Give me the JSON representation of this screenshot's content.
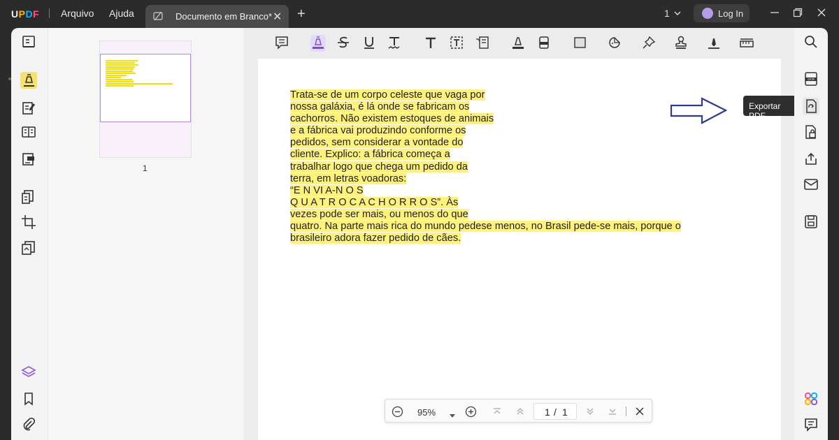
{
  "app": {
    "logo": "UPDF"
  },
  "menu": {
    "file": "Arquivo",
    "help": "Ajuda"
  },
  "tab": {
    "title": "Documento em Branco*"
  },
  "window": {
    "count": "1"
  },
  "account": {
    "login_label": "Log In"
  },
  "thumbnail": {
    "page_number": "1"
  },
  "document": {
    "lines": [
      "Trata-se de um corpo celeste que vaga por",
      "nossa galáxia, é lá onde se fabricam os",
      "cachorros. Não existem estoques de animais",
      "e a fábrica vai produzindo conforme os",
      "pedidos, sem considerar a vontade do",
      "cliente. Explico: a fábrica começa a",
      "trabalhar logo que chega um pedido da",
      "terra, em letras voadoras:",
      "“E N VI A-N O S",
      "Q U A T R O C A C H O R R O S”. Às",
      "vezes pode ser mais, ou menos do que",
      "quatro. Na parte mais rica do mundo pedese menos, no Brasil pede-se mais, porque o",
      "brasileiro adora fazer pedido de cães."
    ],
    "highlight_color": "#fff27a"
  },
  "tooltip": {
    "text": "Exportar PDF"
  },
  "pagenav": {
    "zoom": "95%",
    "current_page": "1",
    "separator": "/",
    "total_pages": "1"
  },
  "colors": {
    "accent": "#b587e0",
    "arrow": "#2c3a96",
    "titlebar": "#2b2b2b"
  },
  "icons": {
    "left_rail": [
      "reader-mode-icon",
      "comment-highlight-icon",
      "edit-pdf-icon",
      "organize-pages-icon",
      "form-icon",
      "convert-icon",
      "crop-icon",
      "page-tools-icon",
      "layers-icon",
      "bookmark-icon",
      "attachment-icon"
    ],
    "toolbar": [
      "note-icon",
      "highlighter-icon",
      "strikethrough-icon",
      "underline-icon",
      "squiggly-icon",
      "text-icon",
      "textbox-icon",
      "text-callout-icon",
      "pencil-icon",
      "eraser-icon",
      "shapes-icon",
      "sticker-icon",
      "pin-icon",
      "stamp-icon",
      "signature-icon",
      "measure-icon"
    ],
    "right_rail": [
      "search-icon",
      "ocr-icon",
      "export-pdf-icon",
      "protect-icon",
      "share-icon",
      "email-icon",
      "save-icon",
      "ai-assistant-icon",
      "comment-list-icon"
    ]
  }
}
